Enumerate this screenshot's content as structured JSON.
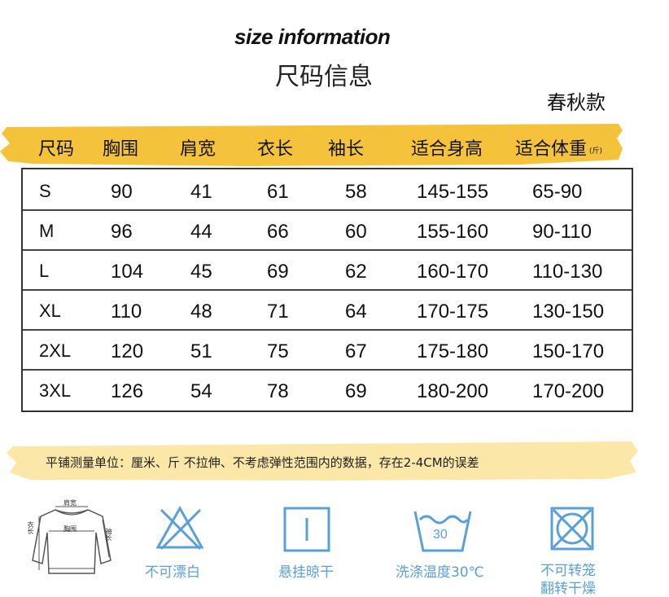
{
  "title_en": "size information",
  "title_cn": "尺码信息",
  "season": "春秋款",
  "colors": {
    "accent_yellow": "#f5c33b",
    "note_yellow": "#fbe7a8",
    "care_blue": "#5aa0d8"
  },
  "table": {
    "headers": [
      "尺码",
      "胸围",
      "肩宽",
      "衣长",
      "袖长",
      "适合身高",
      "适合体重"
    ],
    "weight_unit": "(斤)",
    "rows": [
      [
        "S",
        "90",
        "41",
        "61",
        "58",
        "145-155",
        "65-90"
      ],
      [
        "M",
        "96",
        "44",
        "66",
        "60",
        "155-160",
        "90-110"
      ],
      [
        "L",
        "104",
        "45",
        "69",
        "62",
        "160-170",
        "110-130"
      ],
      [
        "XL",
        "110",
        "48",
        "71",
        "64",
        "170-175",
        "130-150"
      ],
      [
        "2XL",
        "120",
        "51",
        "75",
        "67",
        "175-180",
        "150-170"
      ],
      [
        "3XL",
        "126",
        "54",
        "78",
        "69",
        "180-200",
        "170-200"
      ]
    ]
  },
  "note": "平铺测量单位：厘米、斤   不拉伸、不考虑弹性范围内的数据，存在2-4CM的误差",
  "diagram": {
    "shoulder": "肩宽",
    "chest": "胸围",
    "length": "衣长",
    "sleeve": "袖长"
  },
  "care": [
    {
      "icon": "no-bleach-icon",
      "label": "不可漂白"
    },
    {
      "icon": "hang-dry-icon",
      "label": "悬挂晾干"
    },
    {
      "icon": "wash-30-icon",
      "label": "洗涤温度30℃",
      "temp": "30"
    },
    {
      "icon": "no-tumble-dry-icon",
      "label_lines": [
        "不可转笼",
        "翻转干燥"
      ]
    }
  ]
}
